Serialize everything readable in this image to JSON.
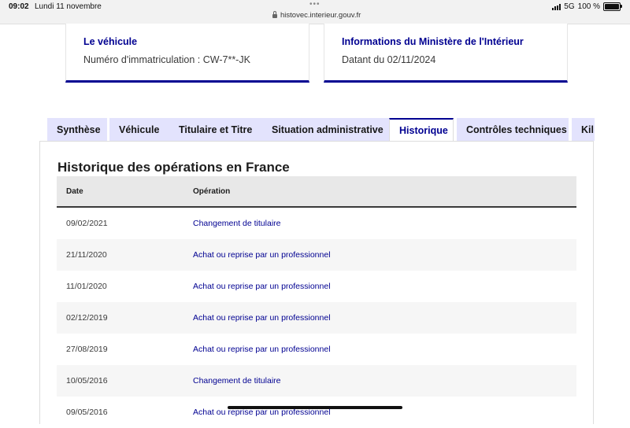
{
  "statusbar": {
    "time": "09:02",
    "date": "Lundi 11 novembre",
    "url": "histovec.interieur.gouv.fr",
    "network": "5G",
    "battery": "100 %"
  },
  "cards": {
    "vehicle": {
      "title": "Le véhicule",
      "value": "Numéro d'immatriculation : CW-7**-JK"
    },
    "ministry": {
      "title": "Informations du Ministère de l'Intérieur",
      "value": "Datant du 02/11/2024"
    }
  },
  "tabs": [
    {
      "label": "Synthèse",
      "active": false
    },
    {
      "label": "Véhicule",
      "active": false
    },
    {
      "label": "Titulaire et Titre",
      "active": false
    },
    {
      "label": "Situation administrative",
      "active": false
    },
    {
      "label": "Historique",
      "active": true
    },
    {
      "label": "Contrôles techniques",
      "active": false
    },
    {
      "label": "Kil",
      "active": false
    }
  ],
  "history": {
    "title": "Historique des opérations en France",
    "columns": [
      "Date",
      "Opération"
    ],
    "rows": [
      {
        "date": "09/02/2021",
        "operation": "Changement de titulaire"
      },
      {
        "date": "21/11/2020",
        "operation": "Achat ou reprise par un professionnel"
      },
      {
        "date": "11/01/2020",
        "operation": "Achat ou reprise par un professionnel"
      },
      {
        "date": "02/12/2019",
        "operation": "Achat ou reprise par un professionnel"
      },
      {
        "date": "27/08/2019",
        "operation": "Achat ou reprise par un professionnel"
      },
      {
        "date": "10/05/2016",
        "operation": "Changement de titulaire"
      },
      {
        "date": "09/05/2016",
        "operation": "Achat ou reprise par un professionnel"
      }
    ]
  },
  "colors": {
    "accent": "#000091",
    "tab_bg": "#e3e3fd"
  }
}
